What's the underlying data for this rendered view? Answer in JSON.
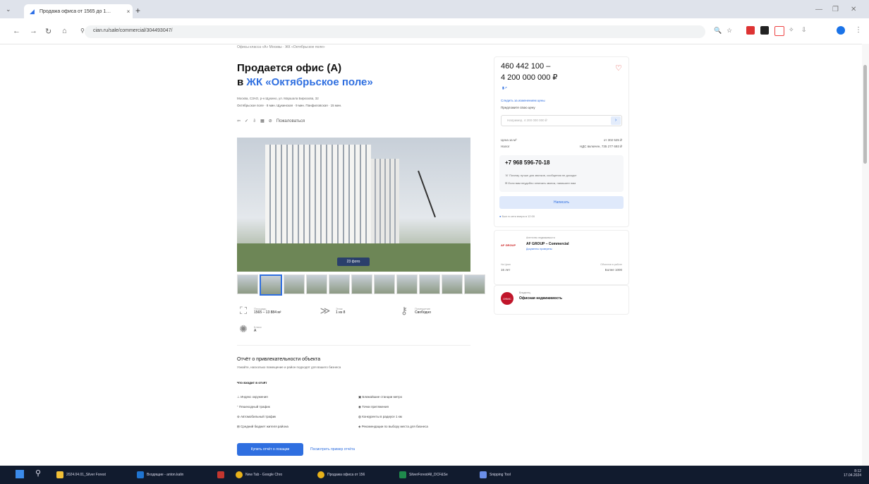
{
  "browser": {
    "tab_title": "Продажа офиса от 1565 до 1…",
    "url": "cian.ru/sale/commercial/304493047/",
    "new_tab": "+",
    "close_tab": "×"
  },
  "page": {
    "breadcrumb": "Офисы класса «А» Москвы · ЖК «Октябрьское поле»",
    "title_line1": "Продается офис (A)",
    "title_pre": "в ",
    "title_link": "ЖК «Октябрьское поле»",
    "address": "Москва, СЗАО, р-н Щукино, ул. Маршала Бирюзова, 32",
    "metro": "Октябрьское поле · 8 мин.   Щукинская · 9 мин.   Панфиловская · 15 мин.",
    "actions_label": "Пожаловаться",
    "photo_count": "23 фото",
    "params": [
      {
        "icon": "area-icon",
        "label": "Площадь",
        "value": "1565 – 13 884 м²"
      },
      {
        "icon": "floor-icon",
        "label": "Этаж",
        "value": "1 из 8"
      },
      {
        "icon": "key-icon",
        "label": "Помещение",
        "value": "Свободно"
      },
      {
        "icon": "class-icon",
        "label": "Класс",
        "value": "A"
      }
    ]
  },
  "report": {
    "title": "Отчёт о привлекательности объекта",
    "subtitle": "Узнайте, насколько помещение и район подходят для вашего бизнеса",
    "what_label": "Что входит в отчёт",
    "left_items": [
      "Индекс окружения",
      "Пешеходный трафик",
      "Автомобильный трафик",
      "Средний бюджет жителя района"
    ],
    "right_items": [
      "Ближайшие станции метро",
      "Точки притяжения",
      "Конкуренты в радиусе 1 км",
      "Рекомендации по выбору места для бизнеса"
    ],
    "get_button": "Купить отчёт о локации",
    "sample_link": "Посмотреть пример отчёта"
  },
  "sidebar": {
    "price_line1": "460 442 100 –",
    "price_line2": "4 200 000 000 ₽",
    "notify_link": "Следить за изменением цены",
    "offer_label": "Предложите свою цену",
    "offer_placeholder": "Например, 4 200 000 000 ₽",
    "rows": [
      {
        "k": "Цена за м²",
        "v": "от 302 525 ₽"
      },
      {
        "k": "Налог",
        "v": "НДС включен, 735 277 693 ₽"
      }
    ],
    "phone": "+7 968 596-70-18",
    "phone_note1": "Почему лучше для звонков, сообщения не доходят",
    "phone_note2": "Если вам неудобно отвечать звонок, напишите нам",
    "message_button": "Написать",
    "online_note": "Был в сети вчера в 12:00",
    "agency": {
      "caption": "Агентство недвижимости",
      "name": "AF GROUP – Commercial",
      "docs": "Документы проверены",
      "k1": "На Циан",
      "v1": "16 лет",
      "k2": "Объектов в работе",
      "v2": "Более 1000"
    },
    "owner": {
      "caption": "Владелец",
      "name": "Офисная недвижимость",
      "badge": "ОФИС"
    }
  },
  "taskbar": {
    "items": [
      "2024.04.01_Silver Forest",
      "Входящие - anton.kalin",
      "New Tab - Google Chro",
      "Продажа офиса от 156",
      "SilverForestAll_DCF&Se",
      "Snipping Tool"
    ],
    "time": "8:12",
    "date": "17.04.2024"
  },
  "colors": {
    "accent": "#2f6fe0",
    "heart": "#e2443b",
    "taskbar": "#111b2e"
  }
}
